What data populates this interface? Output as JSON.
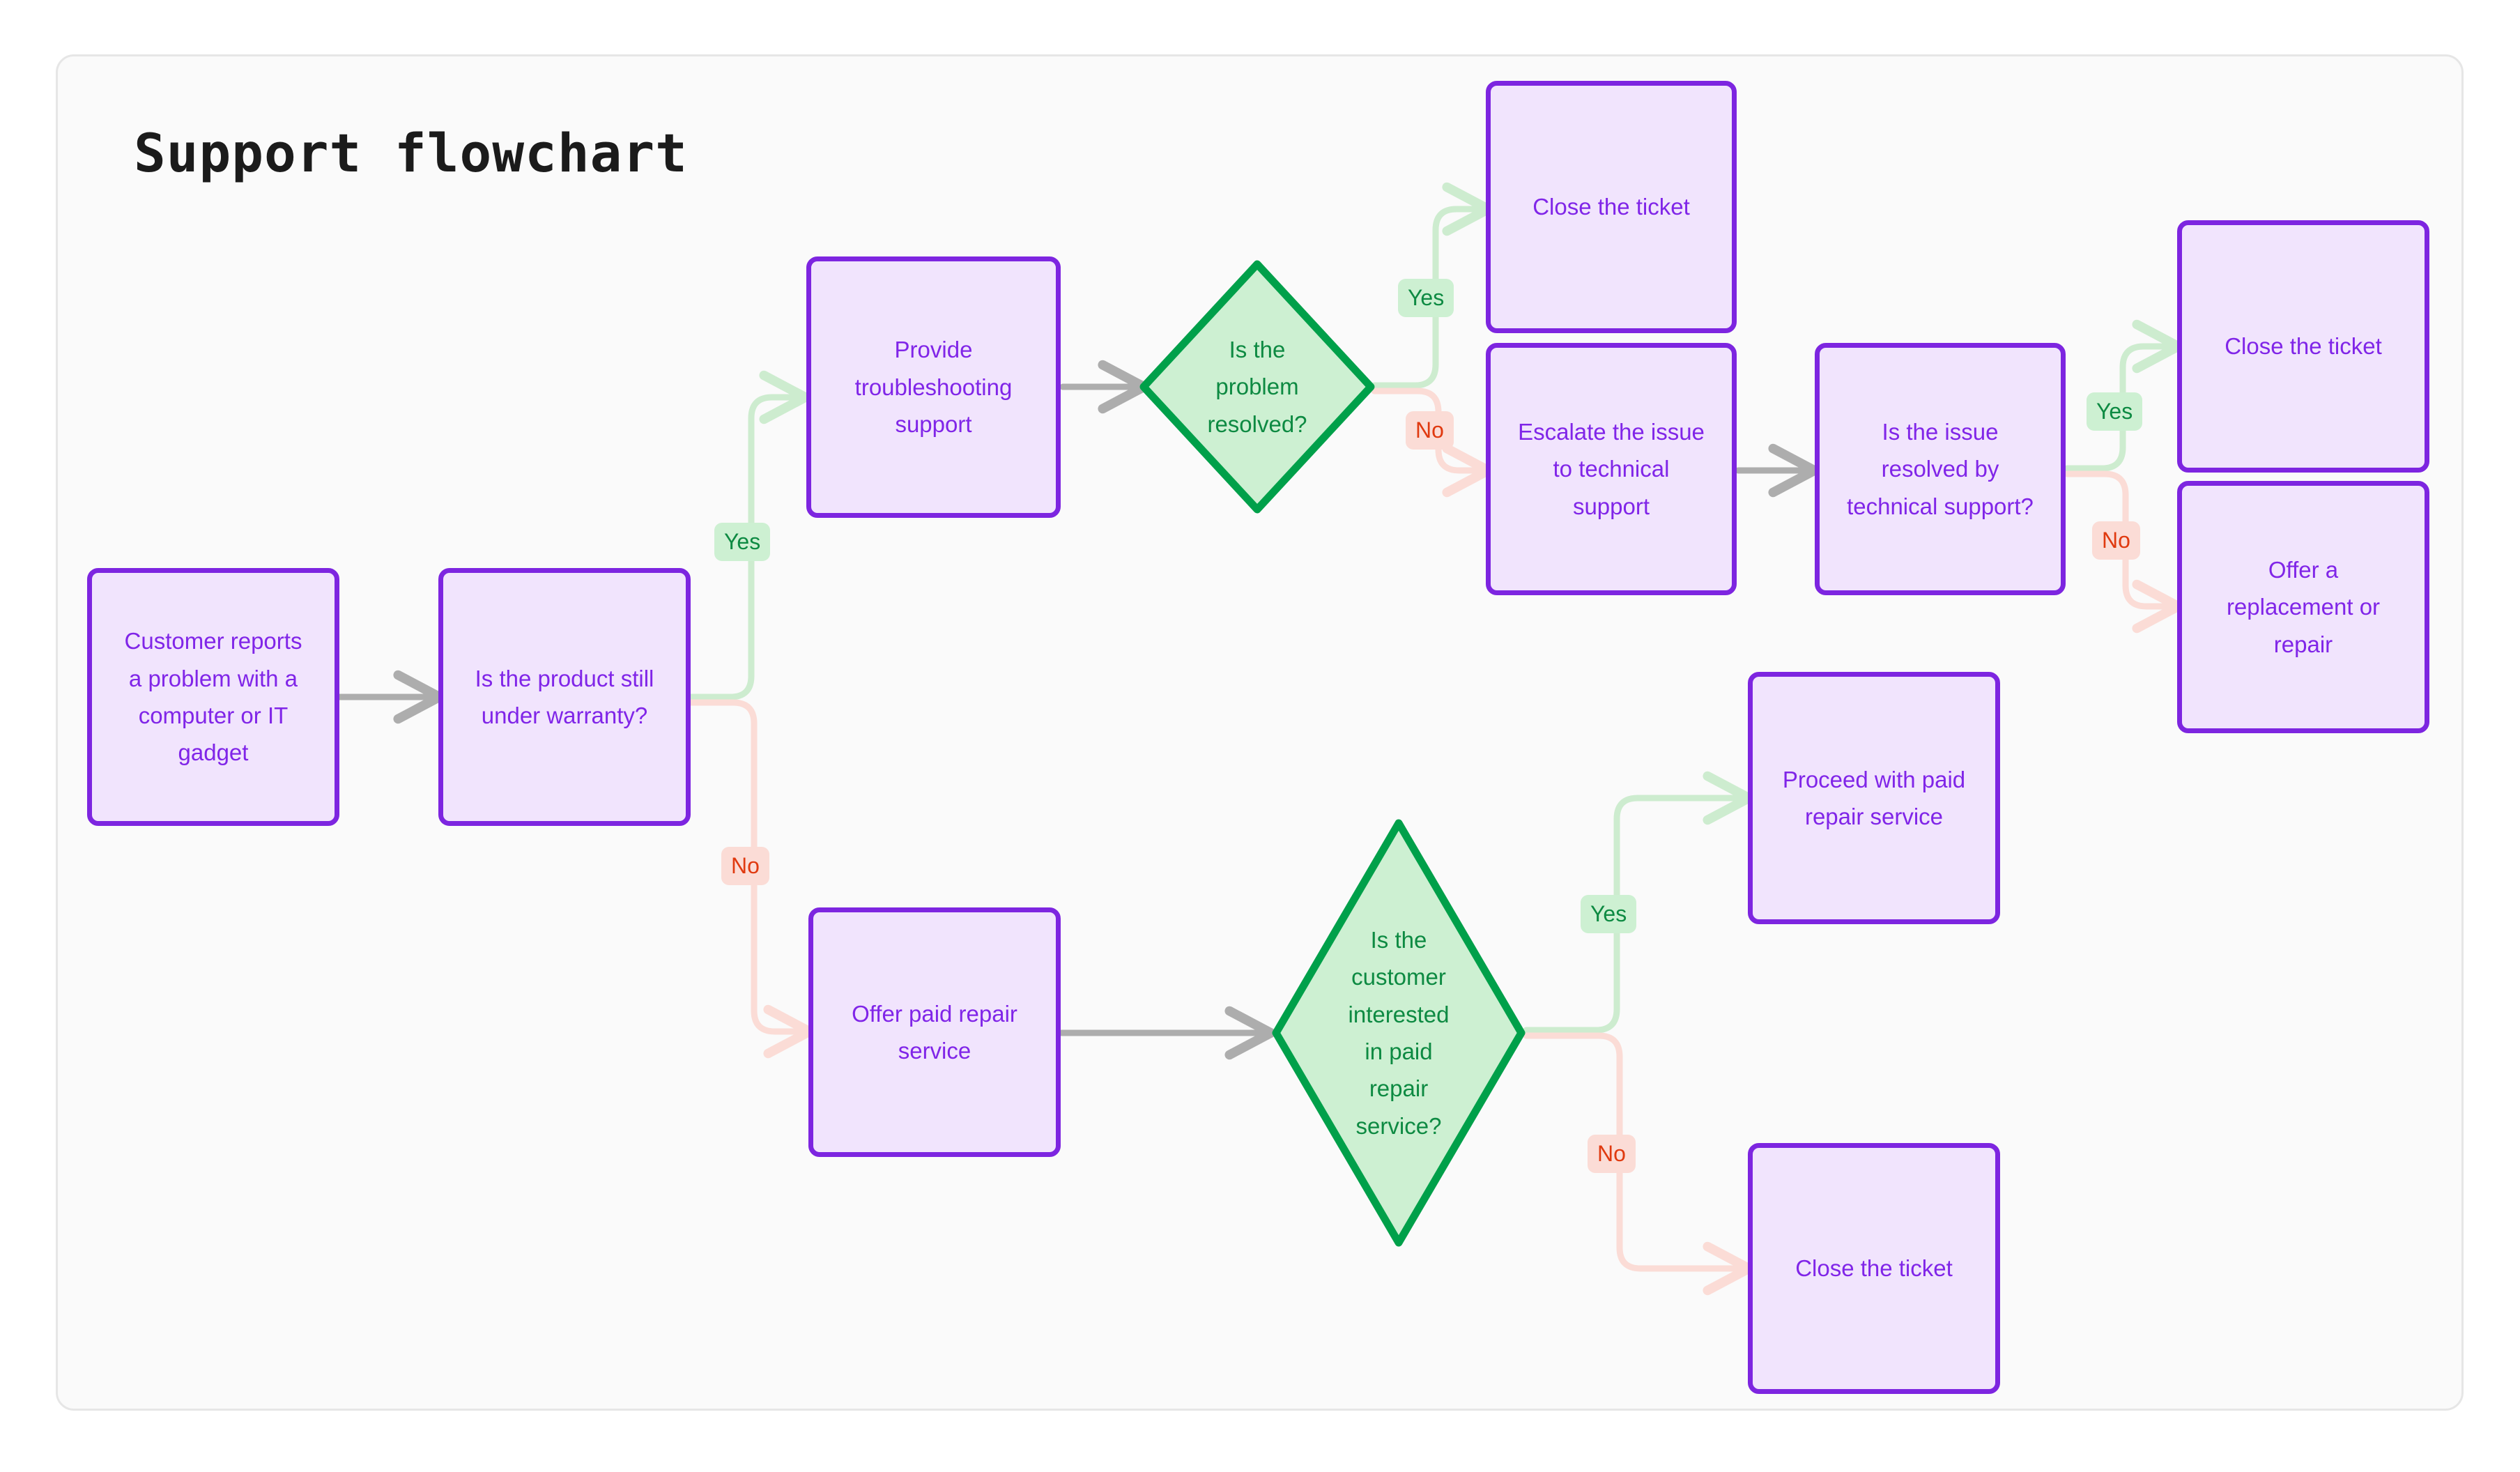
{
  "diagram": {
    "title": "Support flowchart",
    "colors": {
      "node_fill": "#f1e4fd",
      "node_border": "#7d25e0",
      "node_text": "#8025e8",
      "decision_fill": "#cdf0d2",
      "decision_border": "#00a04a",
      "decision_text": "#0d8a42",
      "yes_badge_bg": "#cdf0d2",
      "yes_badge_text": "#0d8a42",
      "no_badge_bg": "#fbdcd6",
      "no_badge_text": "#e03a10",
      "edge_neutral": "#adadad",
      "edge_yes": "#cdeccf",
      "edge_no": "#fbdcd6",
      "frame_bg": "#fafafa",
      "frame_border": "#e6e6e6"
    },
    "nodes": [
      {
        "id": "start",
        "shape": "rect",
        "label": "Customer reports\na problem with a\ncomputer or IT\ngadget"
      },
      {
        "id": "warranty",
        "shape": "rect",
        "label": "Is the product still\nunder warranty?"
      },
      {
        "id": "troubleshoot",
        "shape": "rect",
        "label": "Provide\ntroubleshooting\nsupport"
      },
      {
        "id": "problem_solved",
        "shape": "diamond",
        "label": "Is the\nproblem\nresolved?"
      },
      {
        "id": "close_top",
        "shape": "rect",
        "label": "Close the ticket"
      },
      {
        "id": "escalate",
        "shape": "rect",
        "label": "Escalate the issue\nto technical\nsupport"
      },
      {
        "id": "tech_resolved",
        "shape": "rect",
        "label": "Is the issue\nresolved by\ntechnical support?"
      },
      {
        "id": "close_right",
        "shape": "rect",
        "label": "Close the ticket"
      },
      {
        "id": "replace_repair",
        "shape": "rect",
        "label": "Offer a\nreplacement or\nrepair"
      },
      {
        "id": "offer_paid",
        "shape": "rect",
        "label": "Offer paid repair\nservice"
      },
      {
        "id": "interested_paid",
        "shape": "diamond",
        "label": "Is the\ncustomer\ninterested\nin paid\nrepair\nservice?"
      },
      {
        "id": "proceed_paid",
        "shape": "rect",
        "label": "Proceed with paid\nrepair service"
      },
      {
        "id": "close_bottom",
        "shape": "rect",
        "label": "Close the ticket"
      }
    ],
    "edge_labels": {
      "warranty_yes": "Yes",
      "warranty_no": "No",
      "problem_yes": "Yes",
      "problem_no": "No",
      "tech_yes": "Yes",
      "tech_no": "No",
      "paid_yes": "Yes",
      "paid_no": "No"
    },
    "edges": [
      {
        "from": "start",
        "to": "warranty",
        "label": "",
        "kind": "neutral"
      },
      {
        "from": "warranty",
        "to": "troubleshoot",
        "label": "Yes",
        "kind": "yes"
      },
      {
        "from": "warranty",
        "to": "offer_paid",
        "label": "No",
        "kind": "no"
      },
      {
        "from": "troubleshoot",
        "to": "problem_solved",
        "label": "",
        "kind": "neutral"
      },
      {
        "from": "problem_solved",
        "to": "close_top",
        "label": "Yes",
        "kind": "yes"
      },
      {
        "from": "problem_solved",
        "to": "escalate",
        "label": "No",
        "kind": "no"
      },
      {
        "from": "escalate",
        "to": "tech_resolved",
        "label": "",
        "kind": "neutral"
      },
      {
        "from": "tech_resolved",
        "to": "close_right",
        "label": "Yes",
        "kind": "yes"
      },
      {
        "from": "tech_resolved",
        "to": "replace_repair",
        "label": "No",
        "kind": "no"
      },
      {
        "from": "offer_paid",
        "to": "interested_paid",
        "label": "",
        "kind": "neutral"
      },
      {
        "from": "interested_paid",
        "to": "proceed_paid",
        "label": "Yes",
        "kind": "yes"
      },
      {
        "from": "interested_paid",
        "to": "close_bottom",
        "label": "No",
        "kind": "no"
      }
    ]
  }
}
